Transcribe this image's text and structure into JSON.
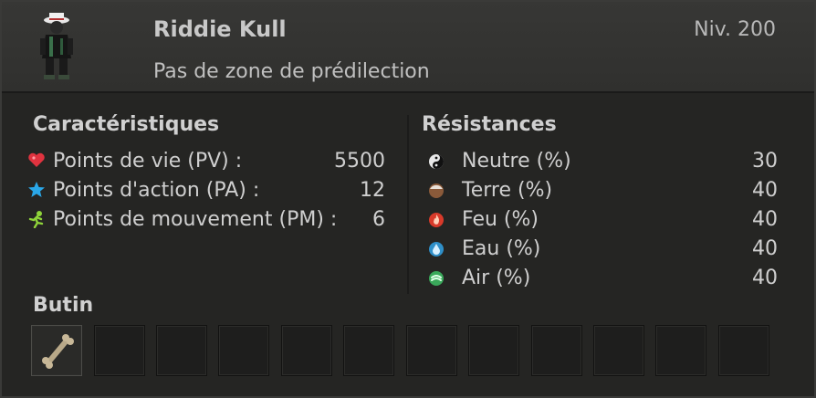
{
  "monster": {
    "name": "Riddie Kull",
    "level": "Niv. 200",
    "zone": "Pas de zone de prédilection"
  },
  "characteristics": {
    "title": "Caractéristiques",
    "items": [
      {
        "icon": "heart-icon",
        "label": "Points de vie (PV) :",
        "value": "5500",
        "color": "#e0333f"
      },
      {
        "icon": "star-icon",
        "label": "Points d'action (PA) :",
        "value": "12",
        "color": "#2aa7e8"
      },
      {
        "icon": "running-man-icon",
        "label": "Points de mouvement (PM) :",
        "value": "6",
        "color": "#8fd43a"
      }
    ]
  },
  "resistances": {
    "title": "Résistances",
    "items": [
      {
        "icon": "neutral-element-icon",
        "label": "Neutre (%)",
        "value": "30",
        "color": "#dddddd"
      },
      {
        "icon": "earth-element-icon",
        "label": "Terre (%)",
        "value": "40",
        "color": "#8a5a3a"
      },
      {
        "icon": "fire-element-icon",
        "label": "Feu (%)",
        "value": "40",
        "color": "#d83a2a"
      },
      {
        "icon": "water-element-icon",
        "label": "Eau (%)",
        "value": "40",
        "color": "#2f8fc8"
      },
      {
        "icon": "air-element-icon",
        "label": "Air (%)",
        "value": "40",
        "color": "#3aa85a"
      }
    ]
  },
  "loot": {
    "title": "Butin",
    "slots": [
      {
        "item": "bone-icon"
      },
      {},
      {},
      {},
      {},
      {},
      {},
      {},
      {},
      {},
      {},
      {}
    ]
  }
}
